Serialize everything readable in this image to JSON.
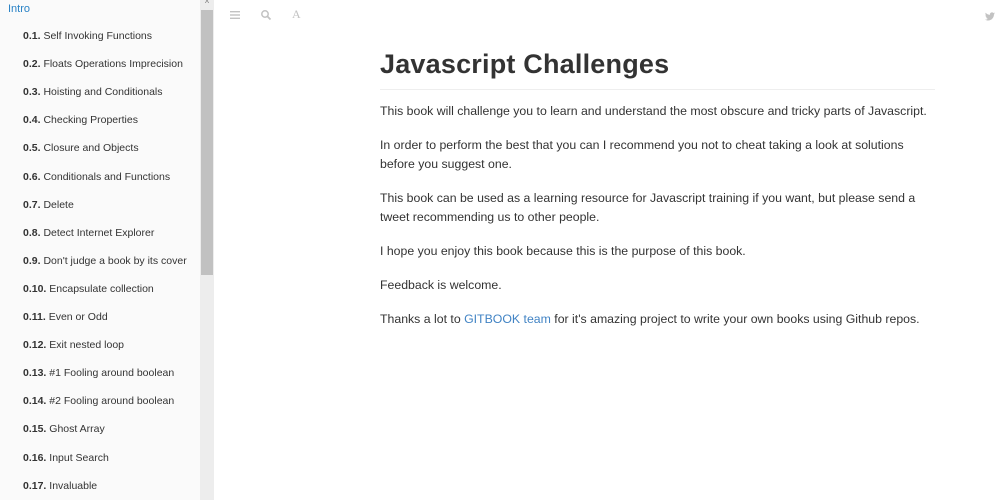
{
  "sidebar": {
    "intro": "Intro",
    "items": [
      {
        "num": "0.1.",
        "label": "Self Invoking Functions"
      },
      {
        "num": "0.2.",
        "label": "Floats Operations Imprecision"
      },
      {
        "num": "0.3.",
        "label": "Hoisting and Conditionals"
      },
      {
        "num": "0.4.",
        "label": "Checking Properties"
      },
      {
        "num": "0.5.",
        "label": "Closure and Objects"
      },
      {
        "num": "0.6.",
        "label": "Conditionals and Functions"
      },
      {
        "num": "0.7.",
        "label": "Delete"
      },
      {
        "num": "0.8.",
        "label": "Detect Internet Explorer"
      },
      {
        "num": "0.9.",
        "label": "Don't judge a book by its cover"
      },
      {
        "num": "0.10.",
        "label": "Encapsulate collection"
      },
      {
        "num": "0.11.",
        "label": "Even or Odd"
      },
      {
        "num": "0.12.",
        "label": "Exit nested loop"
      },
      {
        "num": "0.13.",
        "label": "#1 Fooling around boolean"
      },
      {
        "num": "0.14.",
        "label": "#2 Fooling around boolean"
      },
      {
        "num": "0.15.",
        "label": "Ghost Array"
      },
      {
        "num": "0.16.",
        "label": "Input Search"
      },
      {
        "num": "0.17.",
        "label": "Invaluable"
      }
    ],
    "scroll_up_glyph": "^"
  },
  "toolbar": {
    "menu_icon": "menu-icon",
    "search_icon": "search-icon",
    "font_icon": "font-settings-icon",
    "font_glyph": "A",
    "share_icon": "twitter-icon"
  },
  "content": {
    "title": "Javascript Challenges",
    "p1": "This book will challenge you to learn and understand the most obscure and tricky parts of Javascript.",
    "p2": "In order to perform the best that you can I recommend you not to cheat taking a look at solutions before you suggest one.",
    "p3": "This book can be used as a learning resource for Javascript training if you want, but please send a tweet recommending us to other people.",
    "p4": "I hope you enjoy this book because this is the purpose of this book.",
    "p5": "Feedback is welcome.",
    "p6_before": "Thanks a lot to ",
    "p6_link": "GITBOOK team",
    "p6_after": " for it's amazing project to write your own books using Github repos."
  },
  "colors": {
    "link": "#4183c4",
    "active_nav": "#2a83c6",
    "sidebar_bg": "#fafafa"
  }
}
